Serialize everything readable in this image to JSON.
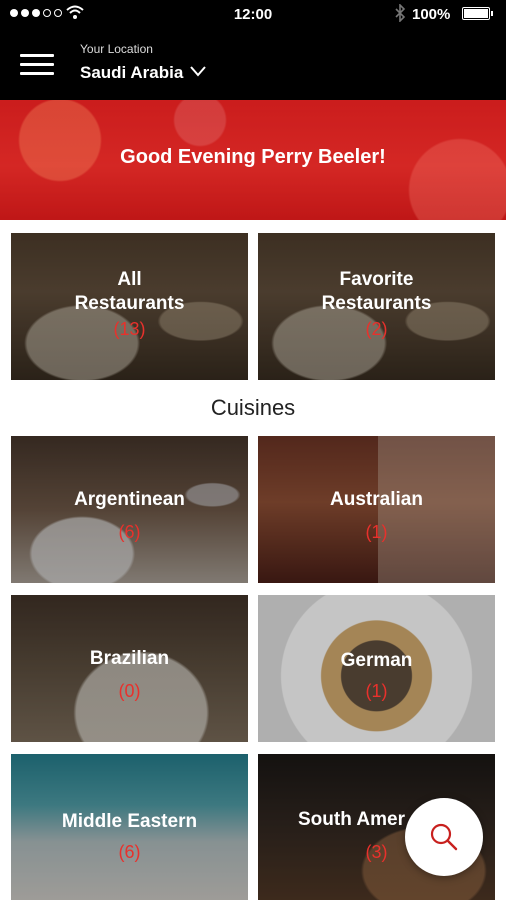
{
  "status_bar": {
    "time": "12:00",
    "battery": "100%"
  },
  "header": {
    "location_label": "Your Location",
    "location_value": "Saudi Arabia"
  },
  "banner": {
    "greeting": "Good Evening Perry Beeler!"
  },
  "restaurants": [
    {
      "line1": "All",
      "line2": "Restaurants",
      "count": "(13)"
    },
    {
      "line1": "Favorite",
      "line2": "Restaurants",
      "count": "(2)"
    }
  ],
  "cuisines_title": "Cuisines",
  "cuisines": [
    {
      "name": "Argentinean",
      "count": "(6)"
    },
    {
      "name": "Australian",
      "count": "(1)"
    },
    {
      "name": "Brazilian",
      "count": "(0)"
    },
    {
      "name": "German",
      "count": "(1)"
    },
    {
      "name": "Middle Eastern",
      "count": "(6)"
    },
    {
      "name": "South Amer",
      "count": "(3)"
    }
  ],
  "colors": {
    "accent": "#e8312c",
    "header": "#000000",
    "banner": "#cc2020"
  },
  "icons": {
    "menu": "hamburger-icon",
    "location_dropdown": "chevron-down-icon",
    "search_fab": "search-icon"
  }
}
